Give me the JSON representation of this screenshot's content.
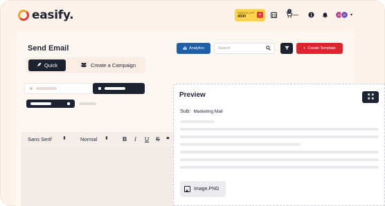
{
  "app": {
    "logo_text": "easify."
  },
  "header": {
    "credits_label": "CREDITS LEFT",
    "credits_value": "4500",
    "credits_add": "+",
    "cart_badge": "0",
    "cart_count": "Hello",
    "avatars": [
      "A",
      "B"
    ]
  },
  "page": {
    "title": "Send Email",
    "tabs": [
      {
        "label": "Quick",
        "active": true,
        "icon": "rocket-icon"
      },
      {
        "label": "Create a Campaign",
        "active": false,
        "icon": "users-icon"
      }
    ]
  },
  "toolbar": {
    "analytics_label": "Analytics",
    "search_placeholder": "Search",
    "create_template_label": "Create Template",
    "accent_blue": "#1f5fa8",
    "accent_red": "#d9262f"
  },
  "editor": {
    "font_family": "Sans Serif",
    "font_size": "Normal",
    "format_buttons": [
      "B",
      "I",
      "U",
      "S",
      "❝"
    ]
  },
  "preview": {
    "title": "Preview",
    "subject_label": "Sub:",
    "subject_value": "Marketing Mail",
    "attachment_name": "Image.PNG"
  }
}
